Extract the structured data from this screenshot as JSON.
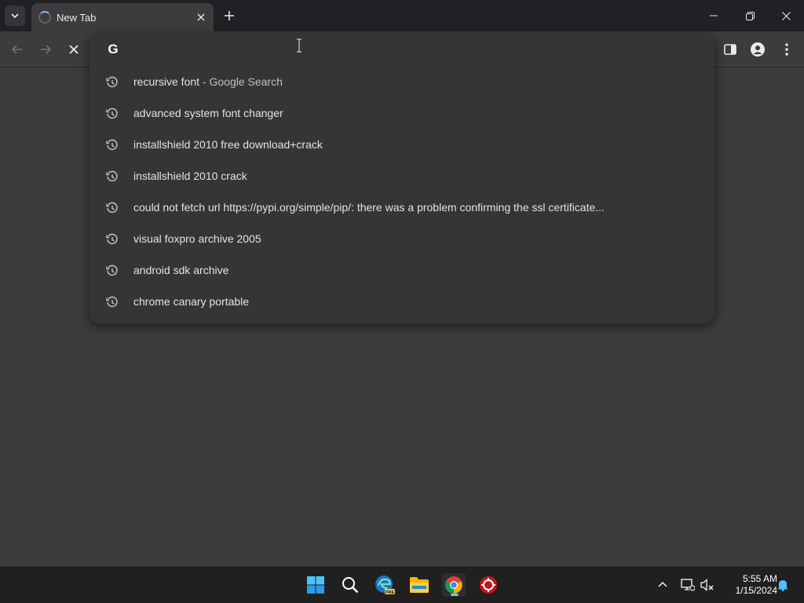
{
  "tab": {
    "title": "New Tab"
  },
  "omnibox": {
    "value": "",
    "suggestions": [
      {
        "text": "recursive font",
        "suffix": " - Google Search"
      },
      {
        "text": "advanced system font changer",
        "suffix": ""
      },
      {
        "text": "installshield 2010 free download+crack",
        "suffix": ""
      },
      {
        "text": "installshield 2010 crack",
        "suffix": ""
      },
      {
        "text": "could not fetch url https://pypi.org/simple/pip/: there was a problem confirming the ssl certificate...",
        "suffix": ""
      },
      {
        "text": "visual foxpro archive 2005",
        "suffix": ""
      },
      {
        "text": "android sdk archive",
        "suffix": ""
      },
      {
        "text": "chrome canary portable",
        "suffix": ""
      }
    ]
  },
  "taskbar": {
    "apps": [
      "start",
      "search",
      "edge-pre",
      "file-explorer",
      "chrome",
      "app-red"
    ],
    "clock_time": "5:55 AM",
    "clock_date": "1/15/2024"
  },
  "colors": {
    "accent": "#60cdff",
    "background": "#3c3c3c",
    "titlebar": "#202124"
  }
}
